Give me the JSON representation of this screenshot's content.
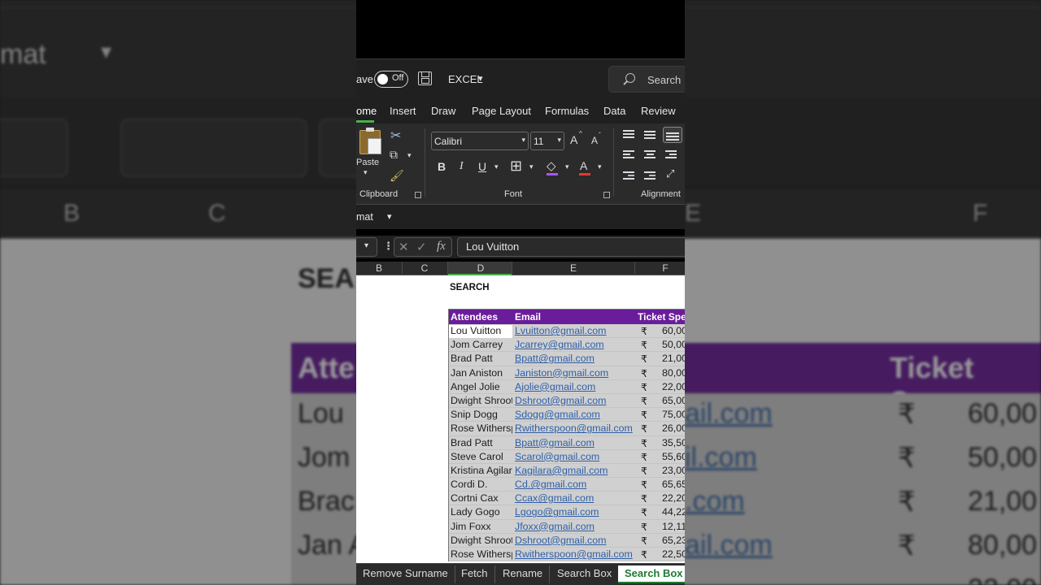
{
  "background": {
    "words": [
      "mat",
      "B",
      "C",
      "E",
      "F",
      "SEA",
      "Atte",
      "Ticket Sper"
    ],
    "names": [
      "Lou",
      "Jom",
      "Brac",
      "Jan A"
    ],
    "emails": [
      "ail.com",
      "il.com",
      ".com",
      "ail.com"
    ],
    "currency": "₹",
    "amounts": [
      "60,00",
      "50,00",
      "21,00",
      "80,00",
      "22,00"
    ]
  },
  "titlebar": {
    "autosave_label": "ave",
    "toggle_label": "Off",
    "file_name": "EXCEL",
    "search_placeholder": "Search"
  },
  "menu": {
    "items": [
      "ome",
      "Insert",
      "Draw",
      "Page Layout",
      "Formulas",
      "Data",
      "Review"
    ]
  },
  "ribbon": {
    "paste_label": "Paste",
    "clipboard_label": "Clipboard",
    "font_label": "Font",
    "alignment_label": "Alignment",
    "font_name": "Calibri",
    "font_size": "11",
    "bold": "B",
    "italic": "I",
    "underline": "U",
    "grow_font": "A",
    "shrink_font": "A",
    "font_color": "A",
    "font_color_hex": "#e53935",
    "fill_color_hex": "#a855f7"
  },
  "format_bar": {
    "label": "mat",
    "dropdown": "▾"
  },
  "formula_bar": {
    "cancel": "✕",
    "enter": "✓",
    "fx": "fx",
    "value": "Lou Vuitton"
  },
  "columns": [
    "B",
    "C",
    "D",
    "E",
    "F"
  ],
  "sheet": {
    "title": "SEARCH",
    "headers": [
      "Attendees",
      "Email",
      "Ticket Sper"
    ],
    "header_color": "#6a1d9a",
    "rows": [
      {
        "name": "Lou Vuitton",
        "email": "Lvuitton@gmail.com",
        "cur": "₹",
        "amt": "60,00"
      },
      {
        "name": "Jom Carrey",
        "email": "Jcarrey@gmail.com",
        "cur": "₹",
        "amt": "50,00"
      },
      {
        "name": "Brad Patt",
        "email": "Bpatt@gmail.com",
        "cur": "₹",
        "amt": "21,00"
      },
      {
        "name": "Jan Aniston",
        "email": "Janiston@gmail.com",
        "cur": "₹",
        "amt": "80,00"
      },
      {
        "name": "Angel Jolie",
        "email": "Ajolie@gmail.com",
        "cur": "₹",
        "amt": "22,00"
      },
      {
        "name": "Dwight Shroot",
        "email": "Dshroot@gmail.com",
        "cur": "₹",
        "amt": "65,00"
      },
      {
        "name": "Snip Dogg",
        "email": "Sdogg@gmail.com",
        "cur": "₹",
        "amt": "75,00"
      },
      {
        "name": "Rose Witherspoon",
        "email": "Rwitherspoon@gmail.com",
        "cur": "₹",
        "amt": "26,00"
      },
      {
        "name": "Brad Patt",
        "email": "Bpatt@gmail.com",
        "cur": "₹",
        "amt": "35,50"
      },
      {
        "name": "Steve Carol",
        "email": "Scarol@gmail.com",
        "cur": "₹",
        "amt": "55,60"
      },
      {
        "name": "Kristina Agilar",
        "email": "Kagilara@gmail.com",
        "cur": "₹",
        "amt": "23,00"
      },
      {
        "name": "Cordi D.",
        "email": "Cd.@gmail.com",
        "cur": "₹",
        "amt": "65,65"
      },
      {
        "name": "Cortni Cax",
        "email": "Ccax@gmail.com",
        "cur": "₹",
        "amt": "22,20"
      },
      {
        "name": "Lady Gogo",
        "email": "Lgogo@gmail.com",
        "cur": "₹",
        "amt": "44,22"
      },
      {
        "name": "Jim Foxx",
        "email": "Jfoxx@gmail.com",
        "cur": "₹",
        "amt": "12,11"
      },
      {
        "name": "Dwight Shroot",
        "email": "Dshroot@gmail.com",
        "cur": "₹",
        "amt": "65,23"
      },
      {
        "name": "Rose Witherspoon",
        "email": "Rwitherspoon@gmail.com",
        "cur": "₹",
        "amt": "22,50"
      }
    ]
  },
  "tabs": [
    "Remove Surname",
    "Fetch",
    "Rename",
    "Search Box",
    "Search Box"
  ],
  "active_tab_index": 4
}
